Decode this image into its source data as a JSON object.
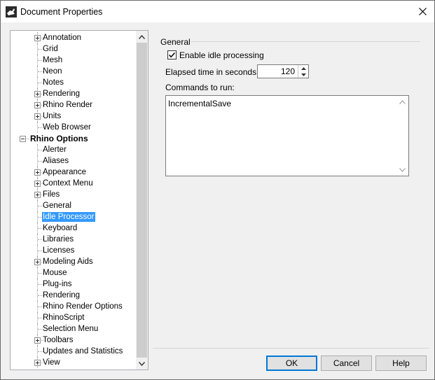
{
  "window": {
    "title": "Document Properties",
    "close_glyph": "✕"
  },
  "tree": {
    "items": [
      {
        "label": "Annotation",
        "level": 1,
        "expander": "plus"
      },
      {
        "label": "Grid",
        "level": 1,
        "expander": null
      },
      {
        "label": "Mesh",
        "level": 1,
        "expander": null
      },
      {
        "label": "Neon",
        "level": 1,
        "expander": null
      },
      {
        "label": "Notes",
        "level": 1,
        "expander": null
      },
      {
        "label": "Rendering",
        "level": 1,
        "expander": "plus"
      },
      {
        "label": "Rhino Render",
        "level": 1,
        "expander": "plus"
      },
      {
        "label": "Units",
        "level": 1,
        "expander": "plus"
      },
      {
        "label": "Web Browser",
        "level": 1,
        "expander": null
      },
      {
        "label": "Rhino Options",
        "level": 0,
        "expander": "minus",
        "bold": true
      },
      {
        "label": "Alerter",
        "level": 1,
        "expander": null
      },
      {
        "label": "Aliases",
        "level": 1,
        "expander": null
      },
      {
        "label": "Appearance",
        "level": 1,
        "expander": "plus"
      },
      {
        "label": "Context Menu",
        "level": 1,
        "expander": "plus"
      },
      {
        "label": "Files",
        "level": 1,
        "expander": "plus"
      },
      {
        "label": "General",
        "level": 1,
        "expander": null
      },
      {
        "label": "Idle Processor",
        "level": 1,
        "expander": null,
        "selected": true
      },
      {
        "label": "Keyboard",
        "level": 1,
        "expander": null
      },
      {
        "label": "Libraries",
        "level": 1,
        "expander": null
      },
      {
        "label": "Licenses",
        "level": 1,
        "expander": null
      },
      {
        "label": "Modeling Aids",
        "level": 1,
        "expander": "plus"
      },
      {
        "label": "Mouse",
        "level": 1,
        "expander": null
      },
      {
        "label": "Plug-ins",
        "level": 1,
        "expander": null
      },
      {
        "label": "Rendering",
        "level": 1,
        "expander": null
      },
      {
        "label": "Rhino Render Options",
        "level": 1,
        "expander": null
      },
      {
        "label": "RhinoScript",
        "level": 1,
        "expander": null
      },
      {
        "label": "Selection Menu",
        "level": 1,
        "expander": null
      },
      {
        "label": "Toolbars",
        "level": 1,
        "expander": "plus"
      },
      {
        "label": "Updates and Statistics",
        "level": 1,
        "expander": null
      },
      {
        "label": "View",
        "level": 1,
        "expander": "plus"
      }
    ],
    "scroll_up_glyph": "⌃",
    "scroll_down_glyph": "⌄"
  },
  "general": {
    "group_title": "General",
    "enable_idle_label": "Enable idle processing",
    "enable_idle_checked": true,
    "elapsed_label": "Elapsed time in seconds:",
    "elapsed_value": "120",
    "commands_label": "Commands to run:",
    "commands_value": "IncrementalSave"
  },
  "buttons": {
    "ok": "OK",
    "cancel": "Cancel",
    "help": "Help"
  },
  "colors": {
    "selection": "#3399ff",
    "default_button_border": "#0078d7"
  }
}
